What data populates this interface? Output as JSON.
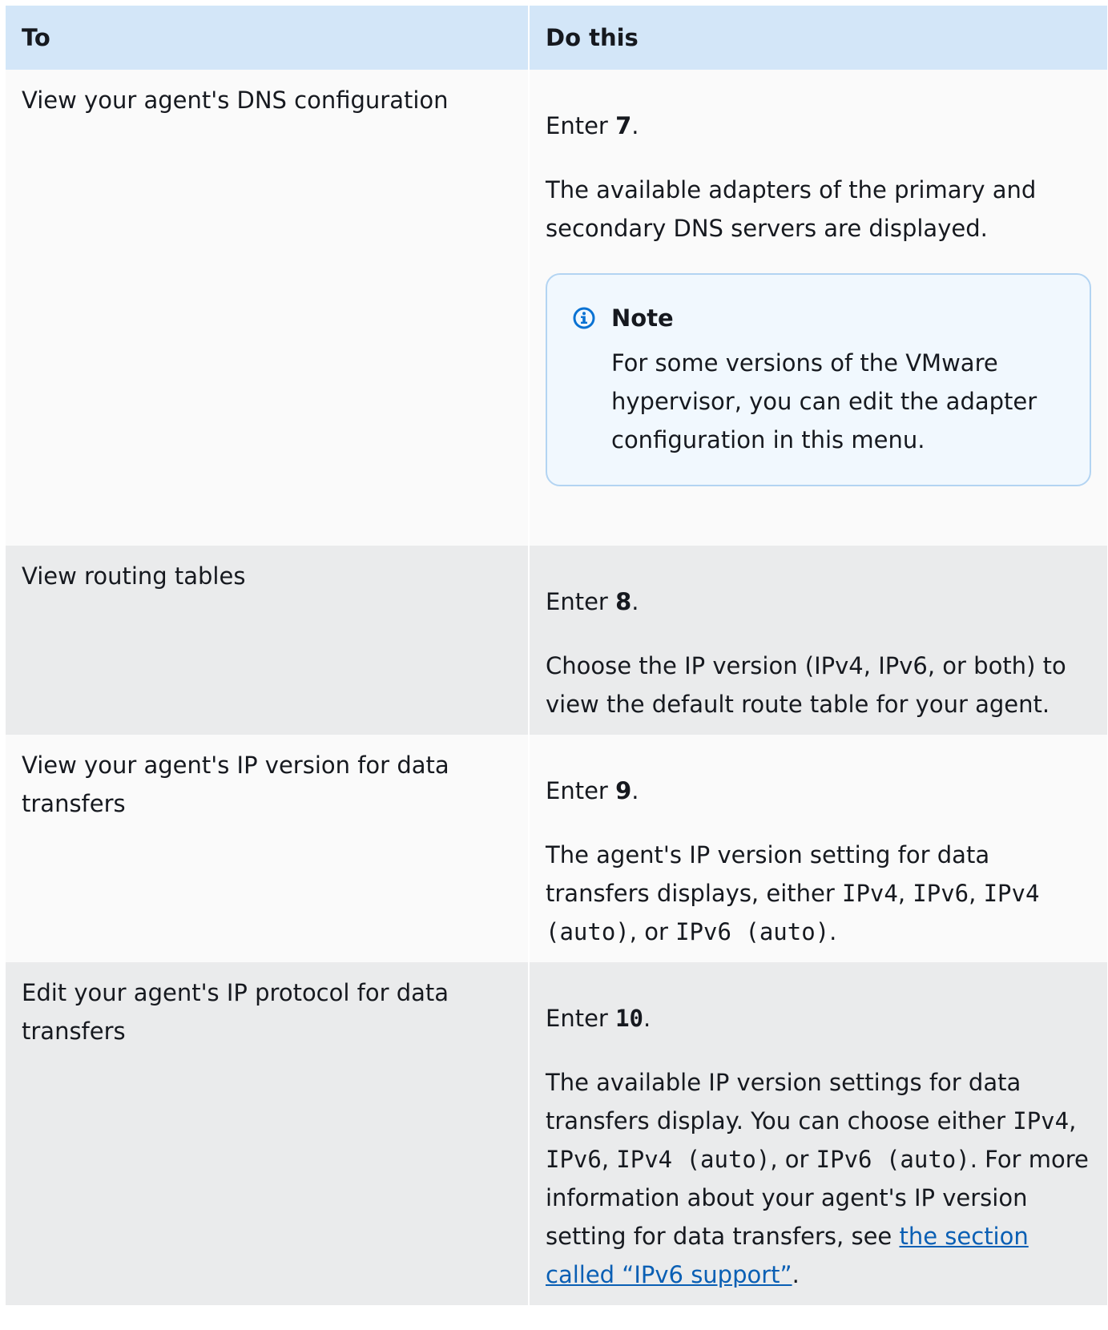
{
  "table": {
    "headers": {
      "to": "To",
      "do": "Do this"
    },
    "rows": [
      {
        "to": "View your agent's DNS configuration",
        "enter_prefix": "Enter ",
        "enter_num": "7",
        "enter_suffix": ".",
        "desc": "The available adapters of the primary and secondary DNS  servers are displayed.",
        "note_title": "Note",
        "note_body": "For some versions of the VMware hypervisor, you can edit the adapter configuration in this  menu."
      },
      {
        "to": "View routing tables",
        "enter_prefix": "Enter ",
        "enter_num": "8",
        "enter_suffix": ".",
        "desc": "Choose the IP version (IPv4, IPv6, or both) to view the default route table for your agent."
      },
      {
        "to": "View your agent's IP version for data transfers",
        "enter_prefix": "Enter ",
        "enter_num": "9",
        "enter_suffix": ".",
        "desc_a": "The agent's IP version setting for data transfers displays, either ",
        "code1": "IPv4",
        "sep1": ", ",
        "code2": "IPv6",
        "sep2": ", ",
        "code3": "IPv4 (auto)",
        "sep3": ", or ",
        "code4": "IPv6 (auto)",
        "end": "."
      },
      {
        "to": "Edit your agent's IP protocol for data transfers",
        "enter_prefix": "Enter ",
        "enter_num": "10",
        "enter_suffix": ".",
        "desc_a": "The available IP version settings for data transfers display.  You can choose either ",
        "code1": "IPv4",
        "sep1": ", ",
        "code2": "IPv6",
        "sep2": ", ",
        "code3": "IPv4 (auto)",
        "sep3": ", or ",
        "code4": "IPv6 (auto)",
        "sep4": ".  For more information about your agent's IP version setting for data transfers, see ",
        "link": "the section called “IPv6 support”",
        "end": "."
      }
    ]
  },
  "colors": {
    "header_bg": "#d3e6f8",
    "row_odd_bg": "#fafafa",
    "row_even_bg": "#eaebec",
    "note_border": "#b3d4f2",
    "note_bg": "#f1f8fe",
    "link": "#0a5fb4",
    "info_icon": "#0972d3"
  },
  "icons": {
    "note": "info-circle-icon"
  }
}
